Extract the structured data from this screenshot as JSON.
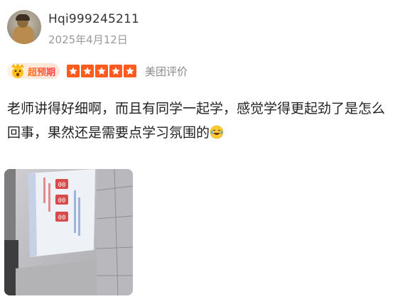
{
  "user": {
    "name": "Hqi999245211",
    "date": "2025年4月12日"
  },
  "rating": {
    "badge_label": "超预期",
    "stars": 5,
    "source": "美团评价"
  },
  "comment": {
    "text": "老师讲得好细啊，而且有同学一起学，感觉学得更起劲了是怎么回事，果然还是需要点学习氛围的",
    "emoji_icon": "tears-of-joy-emoji"
  },
  "photo": {
    "timer_text": "00 : 00 : 00",
    "accent": "#d94a4a"
  },
  "colors": {
    "star": "#ff5b1f",
    "badge_text": "#ff5b1f",
    "meta": "#9a9a9a"
  }
}
